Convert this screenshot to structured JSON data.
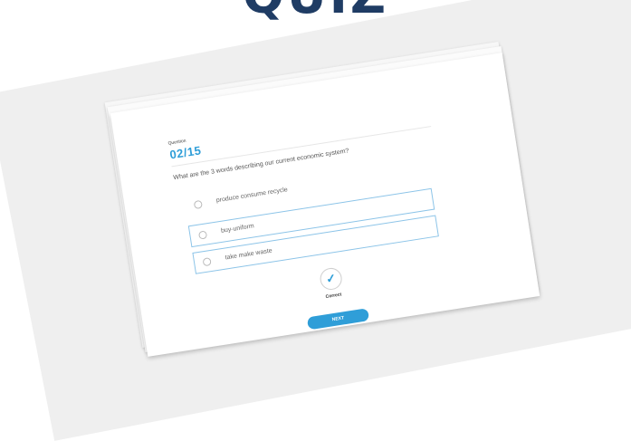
{
  "page": {
    "title": "QUIZ"
  },
  "quiz": {
    "question_label": "Question",
    "counter": "02/15",
    "question_text": "What are the 3 words describing our current economic system?",
    "options": [
      {
        "label": "produce consume recycle",
        "icon": "radio-icon",
        "selected": false
      },
      {
        "label": "buy-uniform",
        "icon": "radio-icon",
        "selected": true
      },
      {
        "label": "take make waste",
        "icon": "check-circle-icon",
        "selected": true
      }
    ],
    "result": {
      "icon": "checkmark-icon",
      "label": "Correct"
    },
    "next_label": "NEXT"
  },
  "colors": {
    "accent": "#2f9ed8",
    "title": "#1f3c64",
    "selection_border": "#8cc4e8"
  }
}
